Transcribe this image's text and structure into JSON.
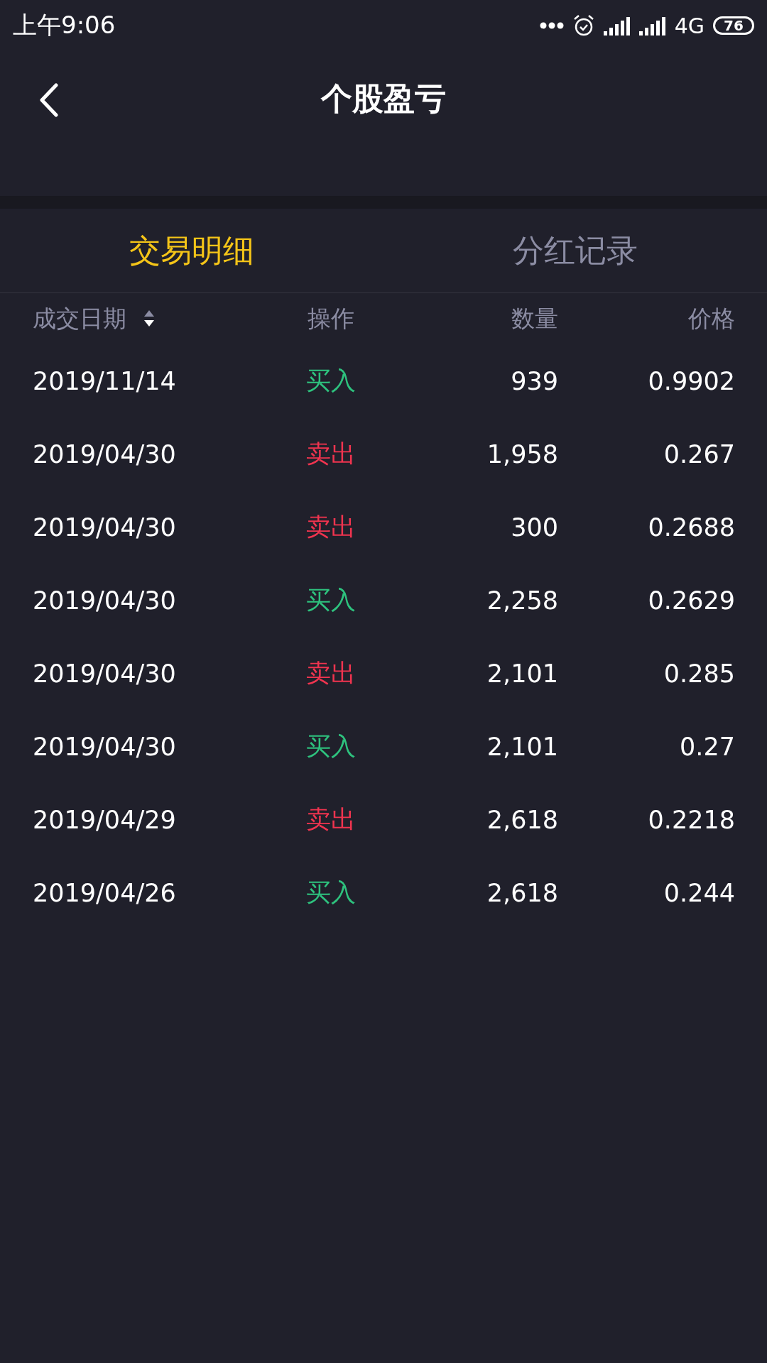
{
  "status_bar": {
    "time": "上午9:06",
    "network": "4G",
    "battery": "76"
  },
  "header": {
    "title": "个股盈亏"
  },
  "tabs": [
    {
      "label": "交易明细",
      "selected": true
    },
    {
      "label": "分红记录",
      "selected": false
    }
  ],
  "table": {
    "columns": [
      "成交日期",
      "操作",
      "数量",
      "价格"
    ],
    "rows": [
      {
        "date": "2019/11/14",
        "action": "买入",
        "kind": "buy",
        "quantity": "939",
        "price": "0.9902"
      },
      {
        "date": "2019/04/30",
        "action": "卖出",
        "kind": "sell",
        "quantity": "1,958",
        "price": "0.267"
      },
      {
        "date": "2019/04/30",
        "action": "卖出",
        "kind": "sell",
        "quantity": "300",
        "price": "0.2688"
      },
      {
        "date": "2019/04/30",
        "action": "买入",
        "kind": "buy",
        "quantity": "2,258",
        "price": "0.2629"
      },
      {
        "date": "2019/04/30",
        "action": "卖出",
        "kind": "sell",
        "quantity": "2,101",
        "price": "0.285"
      },
      {
        "date": "2019/04/30",
        "action": "买入",
        "kind": "buy",
        "quantity": "2,101",
        "price": "0.27"
      },
      {
        "date": "2019/04/29",
        "action": "卖出",
        "kind": "sell",
        "quantity": "2,618",
        "price": "0.2218"
      },
      {
        "date": "2019/04/26",
        "action": "买入",
        "kind": "buy",
        "quantity": "2,618",
        "price": "0.244"
      }
    ]
  }
}
